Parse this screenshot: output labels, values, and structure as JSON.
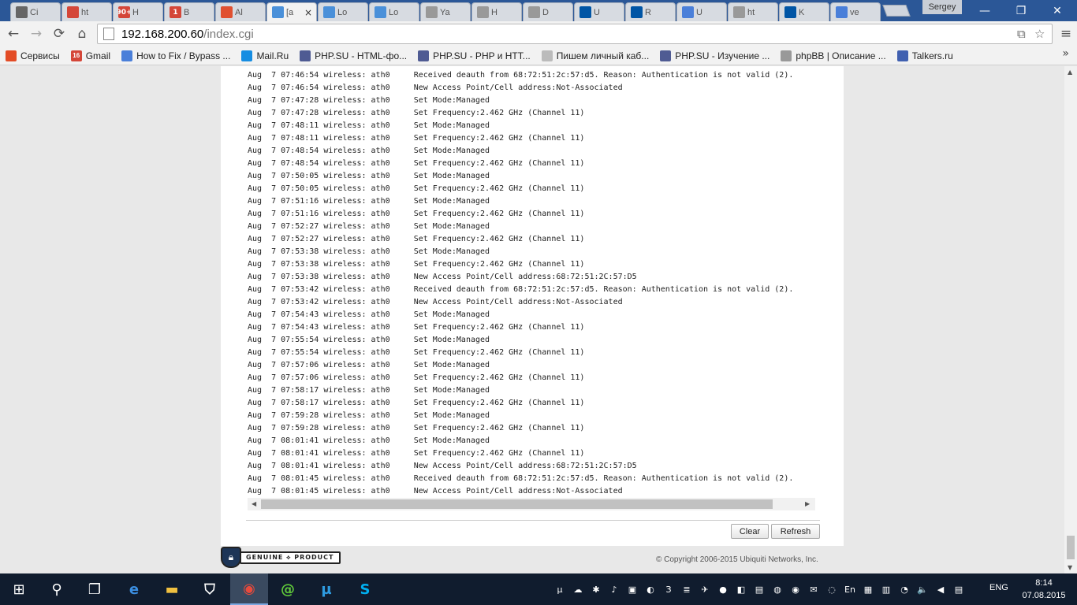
{
  "browser": {
    "tabs": [
      {
        "label": "Ci",
        "icon": "download-icon",
        "color": "#666666"
      },
      {
        "label": "ht",
        "icon": "red-square-icon",
        "color": "#d44638"
      },
      {
        "label": "H",
        "icon": "gmail-icon",
        "color": "#d44638",
        "badge": "90+"
      },
      {
        "label": "B",
        "icon": "gmail-icon",
        "color": "#d44638",
        "badge": "1"
      },
      {
        "label": "Al",
        "icon": "plus-icon",
        "color": "#e05030"
      },
      {
        "label": "[a",
        "icon": "rss-icon",
        "color": "#4a90d9",
        "active": true
      },
      {
        "label": "Lo",
        "icon": "rss-icon",
        "color": "#4a90d9"
      },
      {
        "label": "Lo",
        "icon": "rss-icon",
        "color": "#4a90d9"
      },
      {
        "label": "Ya",
        "icon": "page-icon",
        "color": "#999999"
      },
      {
        "label": "H",
        "icon": "page-icon",
        "color": "#999999"
      },
      {
        "label": "D",
        "icon": "page-icon",
        "color": "#999999"
      },
      {
        "label": "U",
        "icon": "ubiquiti-icon",
        "color": "#0055a5"
      },
      {
        "label": "R",
        "icon": "ubiquiti-icon",
        "color": "#0055a5"
      },
      {
        "label": "U",
        "icon": "google-icon",
        "color": "#4a7fd9"
      },
      {
        "label": "ht",
        "icon": "page-icon",
        "color": "#999999"
      },
      {
        "label": "K",
        "icon": "ubiquiti-icon",
        "color": "#0055a5"
      },
      {
        "label": "ve",
        "icon": "google-icon",
        "color": "#4a7fd9"
      }
    ],
    "tab_close": "×",
    "profile_name": "Sergey",
    "window_controls": {
      "minimize": "—",
      "restore": "❐",
      "close": "✕"
    },
    "nav": {
      "back": "←",
      "forward": "→",
      "reload": "⟳",
      "home": "⌂"
    },
    "url_host": "192.168.200.60",
    "url_path": "/index.cgi",
    "menu": "≡",
    "star": "☆",
    "translate": "⧉",
    "bookmarks": [
      {
        "label": "Сервисы",
        "icon": "apps-icon",
        "color": "#e34c26"
      },
      {
        "label": "Gmail",
        "icon": "gmail-icon",
        "color": "#d44638",
        "badge": "16"
      },
      {
        "label": "How to Fix / Bypass ...",
        "icon": "google-icon",
        "color": "#4a7fd9"
      },
      {
        "label": "Mail.Ru",
        "icon": "mailru-icon",
        "color": "#168de2"
      },
      {
        "label": "PHP.SU - HTML-фо...",
        "icon": "php-icon",
        "color": "#4f5b93"
      },
      {
        "label": "PHP.SU - PHP и HTT...",
        "icon": "php-icon",
        "color": "#4f5b93"
      },
      {
        "label": "Пишем личный каб...",
        "icon": "doc-icon",
        "color": "#bbbbbb"
      },
      {
        "label": "PHP.SU - Изучение ...",
        "icon": "php-icon",
        "color": "#4f5b93"
      },
      {
        "label": "phpBB | Описание ...",
        "icon": "page-icon",
        "color": "#999999"
      },
      {
        "label": "Talkers.ru",
        "icon": "talkers-icon",
        "color": "#4060b0"
      }
    ],
    "bookmarks_more": "»"
  },
  "log": {
    "lines": [
      "Aug  7 07:46:54 wireless: ath0     Received deauth from 68:72:51:2c:57:d5. Reason: Authentication is not valid (2).",
      "Aug  7 07:46:54 wireless: ath0     New Access Point/Cell address:Not-Associated",
      "Aug  7 07:47:28 wireless: ath0     Set Mode:Managed",
      "Aug  7 07:47:28 wireless: ath0     Set Frequency:2.462 GHz (Channel 11)",
      "Aug  7 07:48:11 wireless: ath0     Set Mode:Managed",
      "Aug  7 07:48:11 wireless: ath0     Set Frequency:2.462 GHz (Channel 11)",
      "Aug  7 07:48:54 wireless: ath0     Set Mode:Managed",
      "Aug  7 07:48:54 wireless: ath0     Set Frequency:2.462 GHz (Channel 11)",
      "Aug  7 07:50:05 wireless: ath0     Set Mode:Managed",
      "Aug  7 07:50:05 wireless: ath0     Set Frequency:2.462 GHz (Channel 11)",
      "Aug  7 07:51:16 wireless: ath0     Set Mode:Managed",
      "Aug  7 07:51:16 wireless: ath0     Set Frequency:2.462 GHz (Channel 11)",
      "Aug  7 07:52:27 wireless: ath0     Set Mode:Managed",
      "Aug  7 07:52:27 wireless: ath0     Set Frequency:2.462 GHz (Channel 11)",
      "Aug  7 07:53:38 wireless: ath0     Set Mode:Managed",
      "Aug  7 07:53:38 wireless: ath0     Set Frequency:2.462 GHz (Channel 11)",
      "Aug  7 07:53:38 wireless: ath0     New Access Point/Cell address:68:72:51:2C:57:D5",
      "Aug  7 07:53:42 wireless: ath0     Received deauth from 68:72:51:2c:57:d5. Reason: Authentication is not valid (2).",
      "Aug  7 07:53:42 wireless: ath0     New Access Point/Cell address:Not-Associated",
      "Aug  7 07:54:43 wireless: ath0     Set Mode:Managed",
      "Aug  7 07:54:43 wireless: ath0     Set Frequency:2.462 GHz (Channel 11)",
      "Aug  7 07:55:54 wireless: ath0     Set Mode:Managed",
      "Aug  7 07:55:54 wireless: ath0     Set Frequency:2.462 GHz (Channel 11)",
      "Aug  7 07:57:06 wireless: ath0     Set Mode:Managed",
      "Aug  7 07:57:06 wireless: ath0     Set Frequency:2.462 GHz (Channel 11)",
      "Aug  7 07:58:17 wireless: ath0     Set Mode:Managed",
      "Aug  7 07:58:17 wireless: ath0     Set Frequency:2.462 GHz (Channel 11)",
      "Aug  7 07:59:28 wireless: ath0     Set Mode:Managed",
      "Aug  7 07:59:28 wireless: ath0     Set Frequency:2.462 GHz (Channel 11)",
      "Aug  7 08:01:41 wireless: ath0     Set Mode:Managed",
      "Aug  7 08:01:41 wireless: ath0     Set Frequency:2.462 GHz (Channel 11)",
      "Aug  7 08:01:41 wireless: ath0     New Access Point/Cell address:68:72:51:2C:57:D5",
      "Aug  7 08:01:45 wireless: ath0     Received deauth from 68:72:51:2c:57:d5. Reason: Authentication is not valid (2).",
      "Aug  7 08:01:45 wireless: ath0     New Access Point/Cell address:Not-Associated"
    ]
  },
  "actions": {
    "clear_label": "Clear",
    "refresh_label": "Refresh"
  },
  "footer": {
    "badge_text": "GENUINE ⟡ PRODUCT",
    "copyright": "© Copyright 2006-2015 Ubiquiti Networks, Inc."
  },
  "taskbar": {
    "start": "⊞",
    "search": "⚲",
    "task_view": "❐",
    "apps": [
      {
        "name": "taskbar-edge",
        "glyph": "e",
        "color": "#3b8ee0"
      },
      {
        "name": "taskbar-file-explorer",
        "glyph": "▬",
        "color": "#f0c040"
      },
      {
        "name": "taskbar-store",
        "glyph": "⛉",
        "color": "#ffffff"
      },
      {
        "name": "taskbar-chrome",
        "glyph": "◉",
        "color": "#e84a3c",
        "active": true
      },
      {
        "name": "taskbar-mail-agent",
        "glyph": "@",
        "color": "#5fc83a"
      },
      {
        "name": "taskbar-utorrent",
        "glyph": "µ",
        "color": "#2e9be0"
      },
      {
        "name": "taskbar-skype",
        "glyph": "S",
        "color": "#00aff0"
      }
    ],
    "tray": [
      "µ",
      "☁",
      "✱",
      "♪",
      "▣",
      "◐",
      "З",
      "≣",
      "✈",
      "●",
      "◧",
      "▤",
      "◍",
      "◉",
      "✉",
      "◌",
      "En",
      "▦",
      "▥",
      "◔",
      "🔈",
      "◀",
      "▤"
    ],
    "language": "ENG",
    "time": "8:14",
    "date": "07.08.2015"
  }
}
